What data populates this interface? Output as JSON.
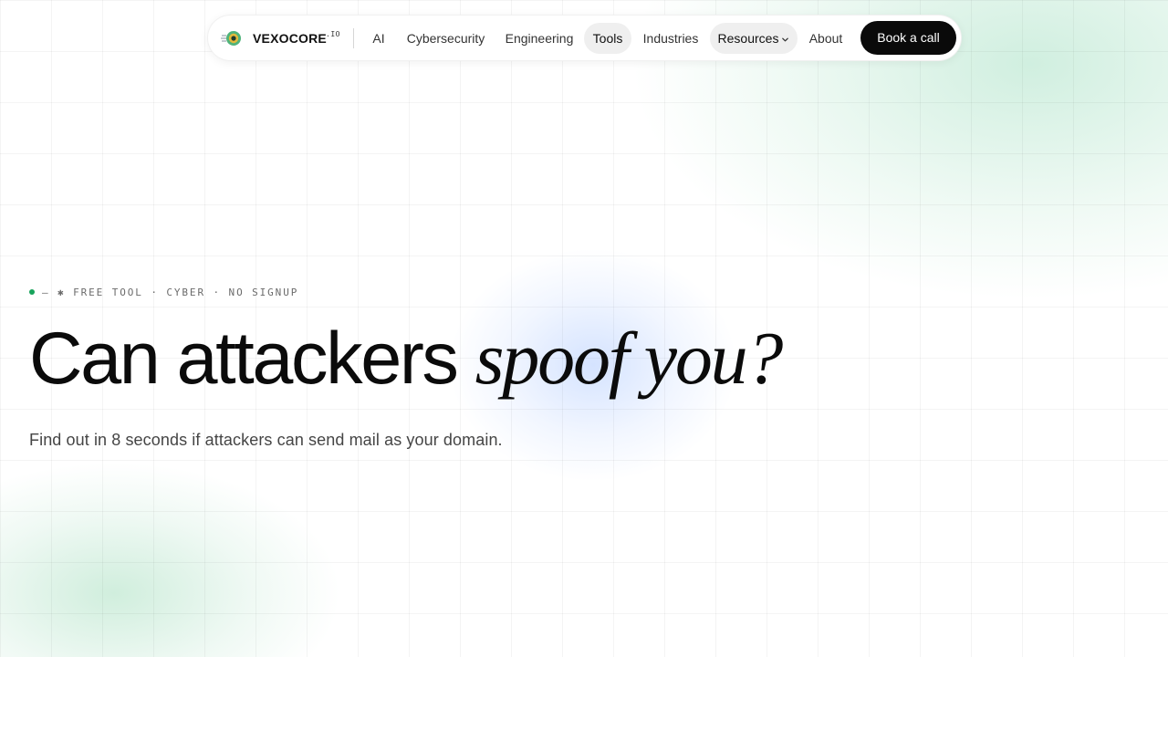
{
  "nav": {
    "brand": "VEXOCORE",
    "brand_suffix": ".IO",
    "links": [
      {
        "label": "AI",
        "active": false
      },
      {
        "label": "Cybersecurity",
        "active": false
      },
      {
        "label": "Engineering",
        "active": false
      },
      {
        "label": "Tools",
        "active": true
      },
      {
        "label": "Industries",
        "active": false
      },
      {
        "label": "Resources",
        "active": true,
        "dropdown": true
      },
      {
        "label": "About",
        "active": false
      }
    ],
    "cta": "Book a call"
  },
  "hero": {
    "eyebrow": "— ✱ FREE TOOL · CYBER · NO SIGNUP",
    "headline_main": "Can attackers ",
    "headline_italic": "spoof you?",
    "subheadline": "Find out in 8 seconds if attackers can send mail as your domain."
  },
  "colors": {
    "accent_green": "#18a35b",
    "cta_background": "#0a0a0a",
    "active_pill": "#efefef"
  },
  "icons": {
    "logo": "vexocore-logo-icon",
    "dropdown": "chevron-down-icon",
    "status": "status-dot-icon"
  }
}
